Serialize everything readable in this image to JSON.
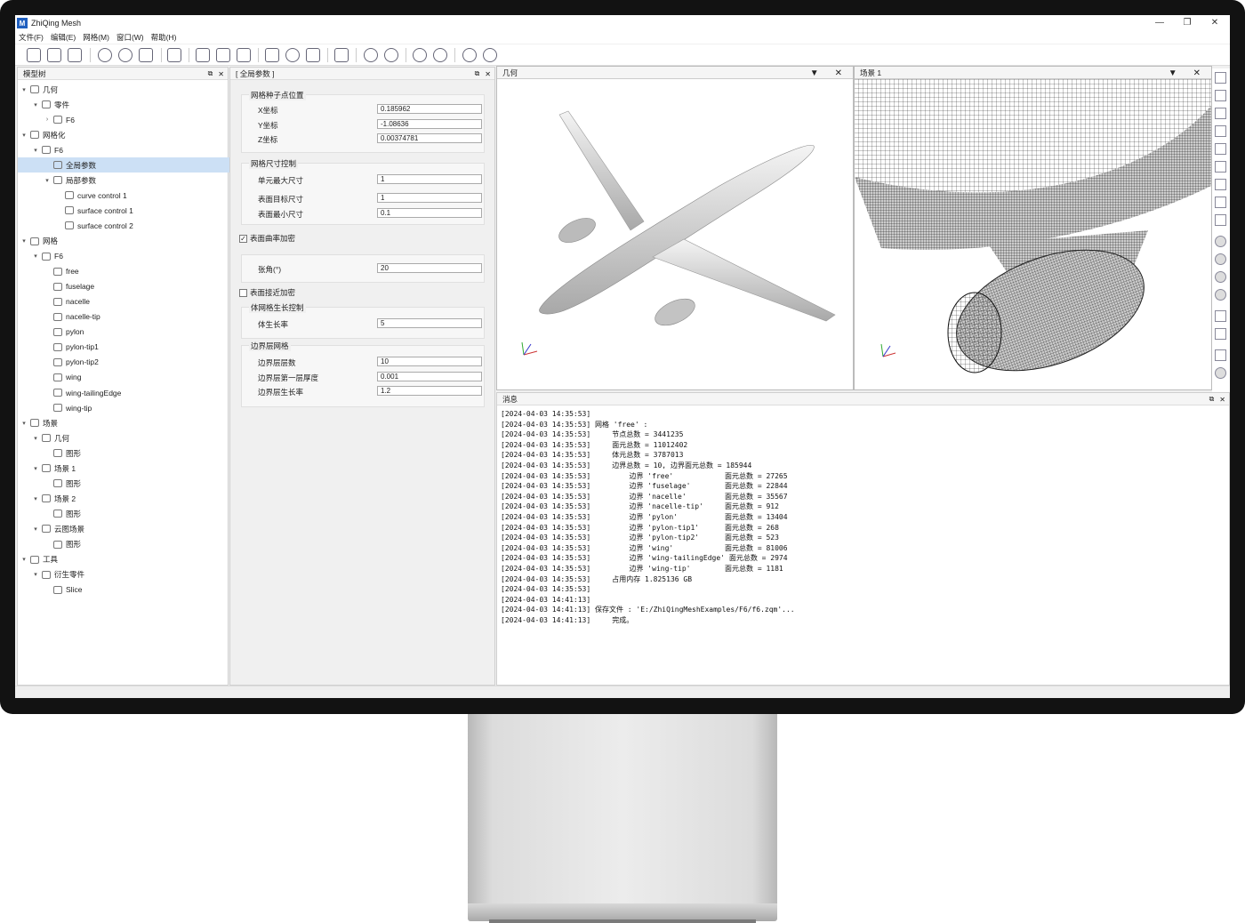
{
  "app": {
    "title": "ZhiQing Mesh",
    "logo": "M",
    "minimize": "—",
    "maximize": "❐",
    "close": "✕"
  },
  "menu": [
    "文件(F)",
    "编辑(E)",
    "网格(M)",
    "窗口(W)",
    "帮助(H)"
  ],
  "model_tree": {
    "title": "模型树",
    "rows": [
      {
        "label": "几何",
        "arrow": "▾",
        "icon": "folder-icon"
      },
      {
        "label": "零件",
        "arrow": "▾",
        "icon": "folder-icon"
      },
      {
        "label": "F6",
        "arrow": "›",
        "icon": "part-icon"
      },
      {
        "label": "网格化",
        "arrow": "▾",
        "icon": "folder-icon"
      },
      {
        "label": "F6",
        "arrow": "▾",
        "icon": "mesh-icon"
      },
      {
        "label": "全局参数",
        "arrow": "",
        "icon": "folder-icon",
        "selected": true
      },
      {
        "label": "局部参数",
        "arrow": "▾",
        "icon": "folder-icon"
      },
      {
        "label": "curve control 1",
        "arrow": "",
        "icon": "curve-icon"
      },
      {
        "label": "surface control 1",
        "arrow": "",
        "icon": "surface-icon"
      },
      {
        "label": "surface control 2",
        "arrow": "",
        "icon": "surface-icon"
      },
      {
        "label": "网格",
        "arrow": "▾",
        "icon": "folder-icon"
      },
      {
        "label": "F6",
        "arrow": "▾",
        "icon": "mesh-icon"
      },
      {
        "label": "free",
        "arrow": "",
        "icon": "boundary-icon"
      },
      {
        "label": "fuselage",
        "arrow": "",
        "icon": "boundary-icon"
      },
      {
        "label": "nacelle",
        "arrow": "",
        "icon": "boundary-icon"
      },
      {
        "label": "nacelle-tip",
        "arrow": "",
        "icon": "boundary-icon"
      },
      {
        "label": "pylon",
        "arrow": "",
        "icon": "boundary-icon"
      },
      {
        "label": "pylon-tip1",
        "arrow": "",
        "icon": "boundary-icon"
      },
      {
        "label": "pylon-tip2",
        "arrow": "",
        "icon": "boundary-icon"
      },
      {
        "label": "wing",
        "arrow": "",
        "icon": "boundary-icon"
      },
      {
        "label": "wing-tailingEdge",
        "arrow": "",
        "icon": "boundary-icon"
      },
      {
        "label": "wing-tip",
        "arrow": "",
        "icon": "boundary-icon"
      },
      {
        "label": "场景",
        "arrow": "▾",
        "icon": "folder-icon"
      },
      {
        "label": "几何",
        "arrow": "▾",
        "icon": "scene-icon"
      },
      {
        "label": "图形",
        "arrow": "",
        "icon": "graphic-icon"
      },
      {
        "label": "场景 1",
        "arrow": "▾",
        "icon": "scene-icon"
      },
      {
        "label": "图形",
        "arrow": "",
        "icon": "graphic-icon"
      },
      {
        "label": "场景 2",
        "arrow": "▾",
        "icon": "scene-icon"
      },
      {
        "label": "图形",
        "arrow": "",
        "icon": "graphic-icon"
      },
      {
        "label": "云图场景",
        "arrow": "▾",
        "icon": "scene-icon"
      },
      {
        "label": "图形",
        "arrow": "",
        "icon": "graphic-icon"
      },
      {
        "label": "工具",
        "arrow": "▾",
        "icon": "folder-icon"
      },
      {
        "label": "衍生零件",
        "arrow": "▾",
        "icon": "folder-icon"
      },
      {
        "label": "Slice",
        "arrow": "",
        "icon": "slice-icon"
      }
    ]
  },
  "params": {
    "title": "[ 全局参数 ]",
    "seed_group": "网格种子点位置",
    "x_label": "X坐标",
    "x_value": "0.185962",
    "y_label": "Y坐标",
    "y_value": "-1.08636",
    "z_label": "Z坐标",
    "z_value": "0.00374781",
    "size_group": "网格尺寸控制",
    "max_label": "单元最大尺寸",
    "max_value": "1",
    "target_label": "表面目标尺寸",
    "target_value": "1",
    "min_label": "表面最小尺寸",
    "min_value": "0.1",
    "curv_check": "表面曲率加密",
    "curv_checked": "✓",
    "angle_label": "张角(°)",
    "angle_value": "20",
    "prox_check": "表面接近加密",
    "prox_checked": "",
    "growth_group": "体网格生长控制",
    "growth_label": "体生长率",
    "growth_value": "5",
    "bl_group": "边界层网格",
    "bl_layers_label": "边界层层数",
    "bl_layers_value": "10",
    "bl_first_label": "边界层第一层厚度",
    "bl_first_value": "0.001",
    "bl_rate_label": "边界层生长率",
    "bl_rate_value": "1.2"
  },
  "viewports": {
    "geometry_title": "几何",
    "scene1_title": "场景 1",
    "dropdown": "▼",
    "close": "✕"
  },
  "messages": {
    "title": "消息",
    "lines": [
      "[2024-04-03 14:35:53]",
      "[2024-04-03 14:35:53] 网格 'free' :",
      "[2024-04-03 14:35:53]     节点总数 = 3441235",
      "[2024-04-03 14:35:53]     面元总数 = 11012402",
      "[2024-04-03 14:35:53]     体元总数 = 3787013",
      "[2024-04-03 14:35:53]     边界总数 = 10, 边界面元总数 = 185944",
      "[2024-04-03 14:35:53]         边界 'free'            面元总数 = 27265",
      "[2024-04-03 14:35:53]         边界 'fuselage'        面元总数 = 22844",
      "[2024-04-03 14:35:53]         边界 'nacelle'         面元总数 = 35567",
      "[2024-04-03 14:35:53]         边界 'nacelle-tip'     面元总数 = 912",
      "[2024-04-03 14:35:53]         边界 'pylon'           面元总数 = 13404",
      "[2024-04-03 14:35:53]         边界 'pylon-tip1'      面元总数 = 268",
      "[2024-04-03 14:35:53]         边界 'pylon-tip2'      面元总数 = 523",
      "[2024-04-03 14:35:53]         边界 'wing'            面元总数 = 81006",
      "[2024-04-03 14:35:53]         边界 'wing-tailingEdge' 面元总数 = 2974",
      "[2024-04-03 14:35:53]         边界 'wing-tip'        面元总数 = 1181",
      "[2024-04-03 14:35:53]     占用内存 1.825136 GB",
      "[2024-04-03 14:35:53]",
      "[2024-04-03 14:41:13]",
      "[2024-04-03 14:41:13] 保存文件 : 'E:/ZhiQingMeshExamples/F6/f6.zqm'...",
      "[2024-04-03 14:41:13]     完成。"
    ]
  },
  "panel_buttons": {
    "float": "⧉",
    "close": "✕"
  }
}
